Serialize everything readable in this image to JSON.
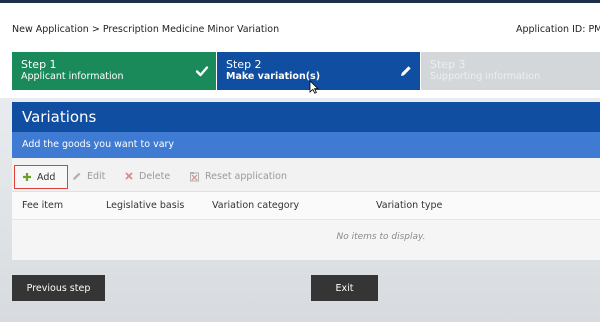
{
  "header": {
    "breadcrumb": "New Application > Prescription Medicine Minor Variation",
    "application_id": "Application ID: PM-"
  },
  "steps": [
    {
      "title": "Step 1",
      "subtitle": "Applicant information",
      "state": "complete",
      "icon": "check-icon"
    },
    {
      "title": "Step 2",
      "subtitle": "Make variation(s)",
      "state": "active",
      "icon": "pencil-icon"
    },
    {
      "title": "Step 3",
      "subtitle": "Supporting information",
      "state": "disabled"
    }
  ],
  "panel": {
    "title": "Variations",
    "subtitle": "Add the goods you want to vary"
  },
  "toolbar": {
    "add_label": "Add",
    "edit_label": "Edit",
    "delete_label": "Delete",
    "reset_label": "Reset application"
  },
  "grid": {
    "columns": [
      "Fee item",
      "Legislative basis",
      "Variation category",
      "Variation type"
    ],
    "empty_text": "No items to display."
  },
  "footer": {
    "previous_label": "Previous step",
    "exit_label": "Exit"
  },
  "colors": {
    "step_complete": "#1a8a5a",
    "step_active": "#0f4ea0",
    "step_disabled": "#d4d7da",
    "panel_header": "#0f4ea0",
    "panel_subheader": "#3f7bd3",
    "add_highlight": "#e0403a",
    "dark_button": "#353535"
  }
}
